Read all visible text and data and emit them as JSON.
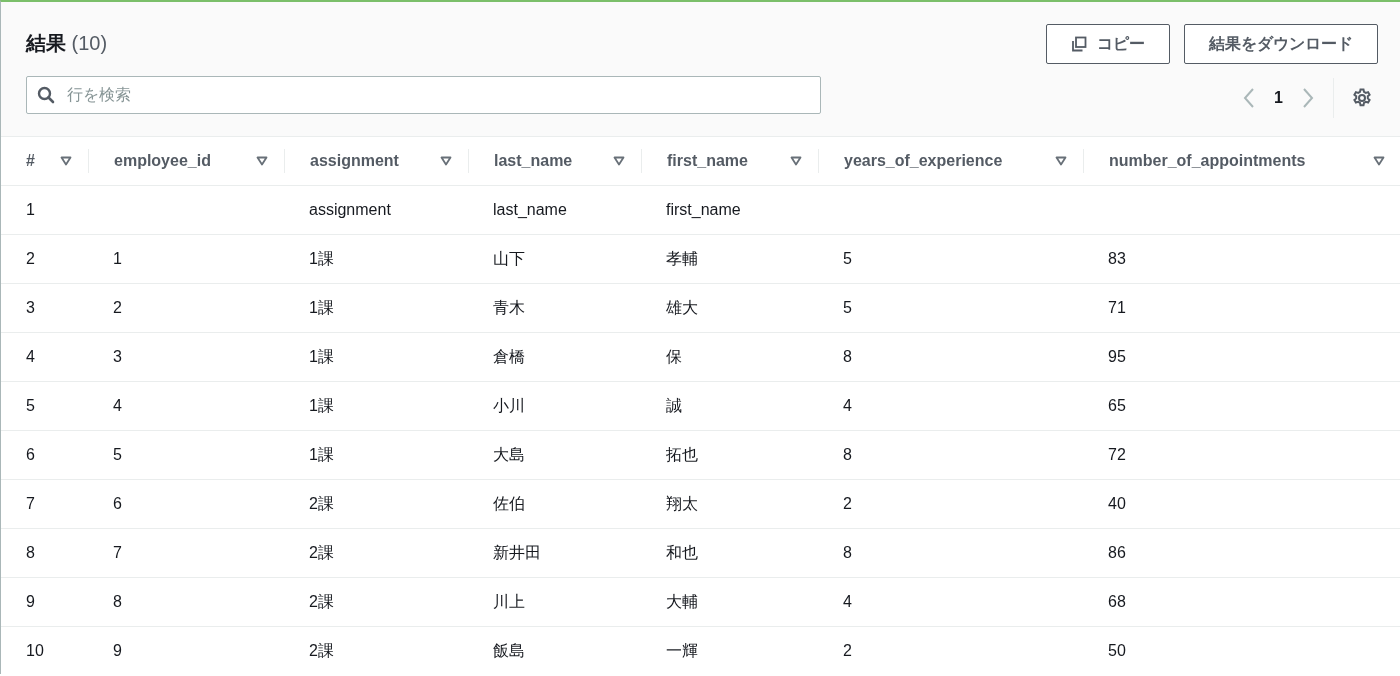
{
  "header": {
    "title": "結果",
    "count": "(10)"
  },
  "buttons": [
    {
      "kind": "copy",
      "label": "コピー"
    },
    {
      "kind": "plain",
      "label": "結果をダウンロード"
    }
  ],
  "search": {
    "placeholder": "行を検索"
  },
  "pagination": {
    "page": "1"
  },
  "table": {
    "columns": [
      "#",
      "employee_id",
      "assignment",
      "last_name",
      "first_name",
      "years_of_experience",
      "number_of_appointments"
    ],
    "rows": [
      [
        "1",
        null,
        "assignment",
        "last_name",
        "first_name",
        null,
        null
      ],
      [
        "2",
        "1",
        "1課",
        "山下",
        "孝輔",
        "5",
        "83"
      ],
      [
        "3",
        "2",
        "1課",
        "青木",
        "雄大",
        "5",
        "71"
      ],
      [
        "4",
        "3",
        "1課",
        "倉橋",
        "保",
        "8",
        "95"
      ],
      [
        "5",
        "4",
        "1課",
        "小川",
        "誠",
        "4",
        "65"
      ],
      [
        "6",
        "5",
        "1課",
        "大島",
        "拓也",
        "8",
        "72"
      ],
      [
        "7",
        "6",
        "2課",
        "佐伯",
        "翔太",
        "2",
        "40"
      ],
      [
        "8",
        "7",
        "2課",
        "新井田",
        "和也",
        "8",
        "86"
      ],
      [
        "9",
        "8",
        "2課",
        "川上",
        "大輔",
        "4",
        "68"
      ],
      [
        "10",
        "9",
        "2課",
        "飯島",
        "一輝",
        "2",
        "50"
      ]
    ]
  }
}
